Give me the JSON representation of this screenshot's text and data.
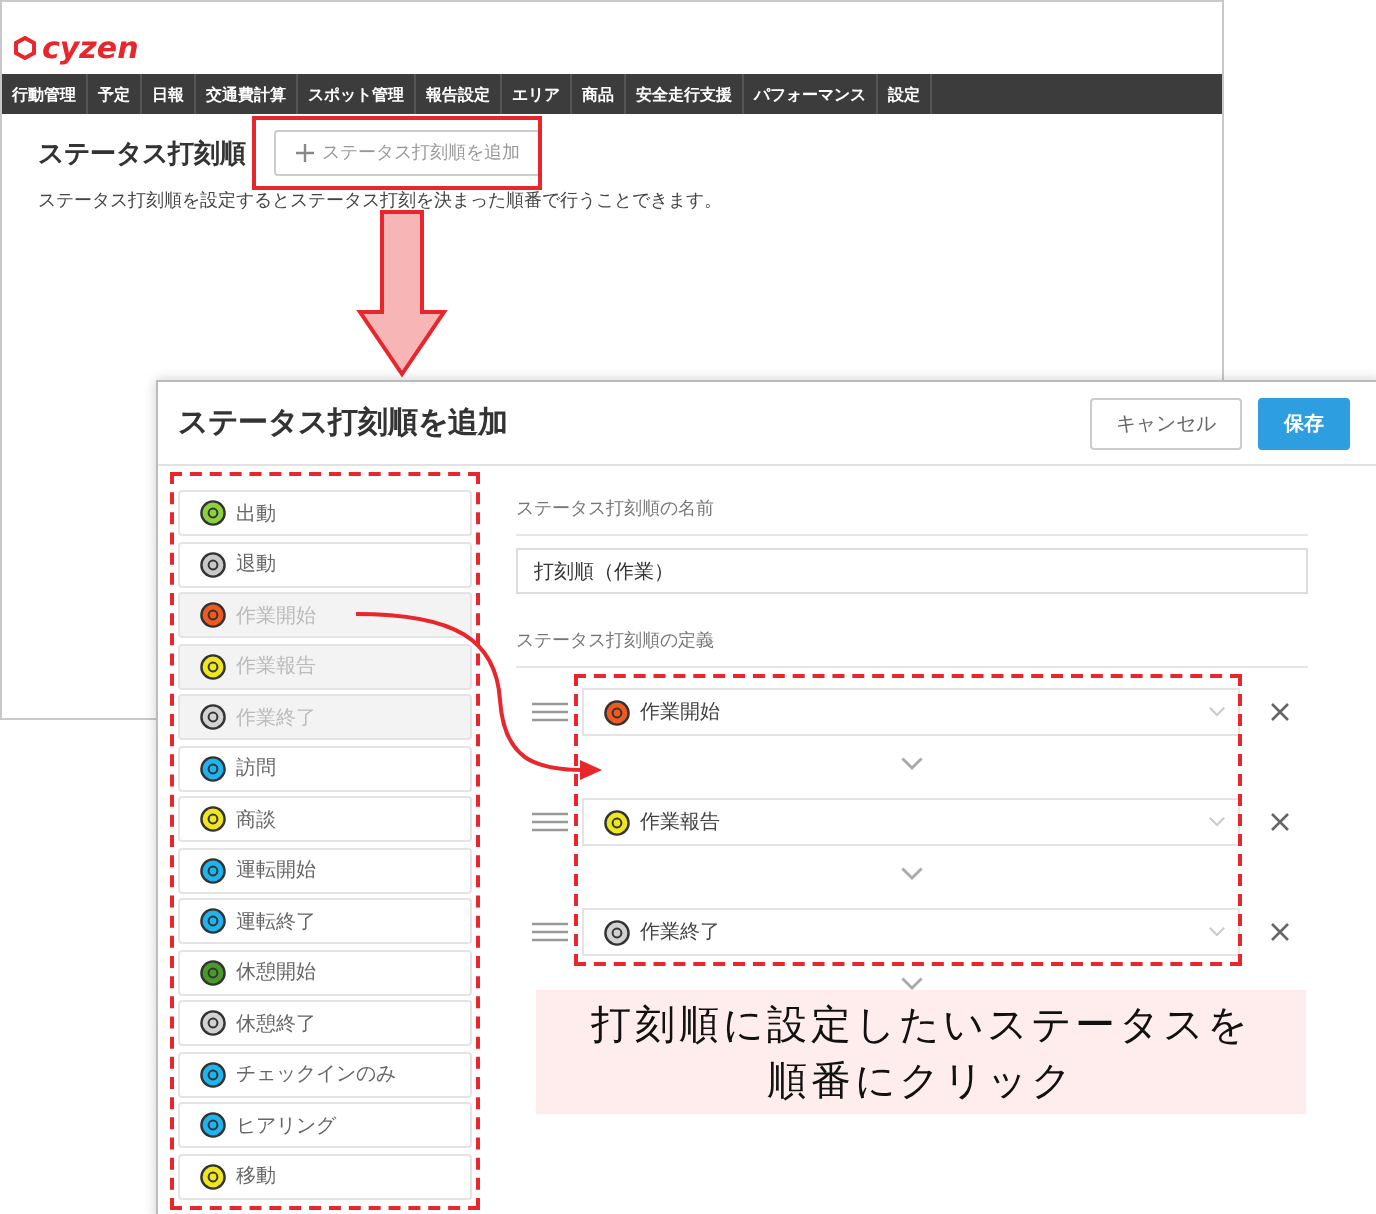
{
  "app": {
    "logo": "cyzen",
    "nav": [
      {
        "label": "行動管理"
      },
      {
        "label": "予定"
      },
      {
        "label": "日報"
      },
      {
        "label": "交通費計算"
      },
      {
        "label": "スポット管理"
      },
      {
        "label": "報告設定"
      },
      {
        "label": "エリア"
      },
      {
        "label": "商品"
      },
      {
        "label": "安全走行支援"
      },
      {
        "label": "パフォーマンス"
      },
      {
        "label": "設定"
      }
    ],
    "page_title": "ステータス打刻順",
    "add_button": "ステータス打刻順を追加",
    "description": "ステータス打刻順を設定するとステータス打刻を決まった順番で行うことできます。"
  },
  "dialog": {
    "title": "ステータス打刻順を追加",
    "buttons": [
      {
        "label": "キャンセル",
        "kind": "secondary"
      },
      {
        "label": "保存",
        "kind": "primary"
      }
    ],
    "statuses": [
      {
        "label": "出動",
        "color": "#8cd23c",
        "disabled": false
      },
      {
        "label": "退動",
        "color": "#c8c8c8",
        "disabled": false
      },
      {
        "label": "作業開始",
        "color": "#f05a1e",
        "disabled": true
      },
      {
        "label": "作業報告",
        "color": "#f0e61e",
        "disabled": true
      },
      {
        "label": "作業終了",
        "color": "#d2d2d2",
        "disabled": true
      },
      {
        "label": "訪問",
        "color": "#1eb4f0",
        "disabled": false
      },
      {
        "label": "商談",
        "color": "#f0e61e",
        "disabled": false
      },
      {
        "label": "運転開始",
        "color": "#1eb4f0",
        "disabled": false
      },
      {
        "label": "運転終了",
        "color": "#1eb4f0",
        "disabled": false
      },
      {
        "label": "休憩開始",
        "color": "#4a9a2a",
        "disabled": false
      },
      {
        "label": "休憩終了",
        "color": "#d2d2d2",
        "disabled": false
      },
      {
        "label": "チェックインのみ",
        "color": "#1eb4f0",
        "disabled": false
      },
      {
        "label": "ヒアリング",
        "color": "#1eb4f0",
        "disabled": false
      },
      {
        "label": "移動",
        "color": "#f0e61e",
        "disabled": false
      }
    ],
    "name_label": "ステータス打刻順の名前",
    "name_value": "打刻順（作業）",
    "definition_label": "ステータス打刻順の定義",
    "steps": [
      {
        "label": "作業開始",
        "color": "#f05a1e"
      },
      {
        "label": "作業報告",
        "color": "#f0e61e"
      },
      {
        "label": "作業終了",
        "color": "#d2d2d2"
      }
    ]
  },
  "annotation": {
    "callout_lines": [
      "打刻順に設定したいステータスを",
      "順番にクリック"
    ]
  }
}
